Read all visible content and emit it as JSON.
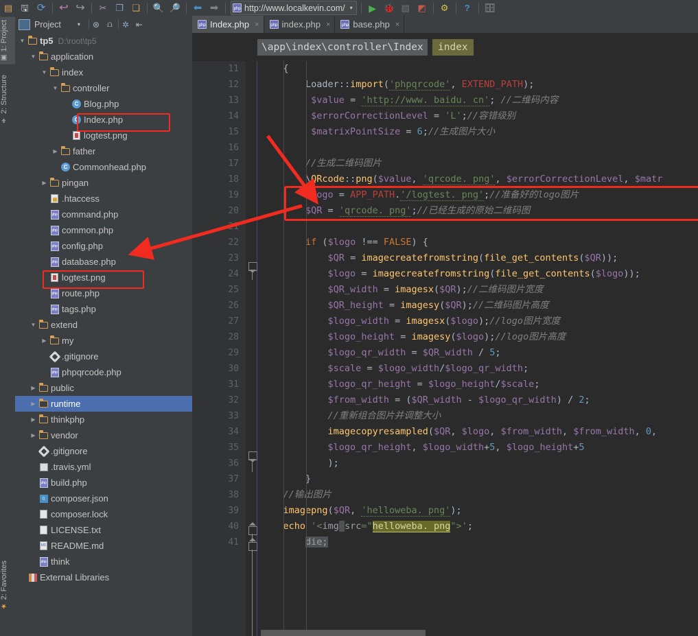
{
  "toolbar": {
    "icons": [
      {
        "name": "open-folder-icon",
        "glyph": "📁"
      },
      {
        "name": "save-all-icon",
        "glyph": "💾"
      },
      {
        "name": "sync-refresh-icon",
        "glyph": "↻"
      },
      {
        "name": "undo-icon",
        "glyph": "↶"
      },
      {
        "name": "redo-icon",
        "glyph": "↷"
      },
      {
        "name": "cut-icon",
        "glyph": "✂"
      },
      {
        "name": "copy-icon",
        "glyph": "❐"
      },
      {
        "name": "paste-icon",
        "glyph": "📋"
      },
      {
        "name": "find-icon",
        "glyph": "🔍"
      },
      {
        "name": "find-usages-icon",
        "glyph": "🔎"
      },
      {
        "name": "back-icon",
        "glyph": "⬅"
      },
      {
        "name": "forward-icon",
        "glyph": "➡"
      }
    ],
    "url_value": "http://www.localkevin.com/",
    "url_dropdown_glyph": "▾",
    "run_icon": "▶",
    "debug_icon": "🐞",
    "coverage_icon": "░",
    "profile_icon": "📊",
    "settings_icon": "⚙",
    "help_icon": "?",
    "deploy_icon": "🗄"
  },
  "left_strip": {
    "project_tab": "1: Project",
    "structure_tab": "2: Structure",
    "favorites_tab": "2: Favorites"
  },
  "project_panel": {
    "title": "Project",
    "caret": "▾",
    "buttons": [
      "⊕",
      "⨍",
      "⚙▾",
      "⇥"
    ]
  },
  "tree": {
    "items": [
      {
        "indent": 0,
        "twisty": "▼",
        "icon": "folder-open",
        "label": "tp5",
        "path": "D:\\root\\tp5",
        "bold": true,
        "selected": false
      },
      {
        "indent": 1,
        "twisty": "▼",
        "icon": "folder-open",
        "label": "application",
        "path": "",
        "bold": false,
        "selected": false
      },
      {
        "indent": 2,
        "twisty": "▼",
        "icon": "folder-open",
        "label": "index",
        "path": "",
        "bold": false,
        "selected": false
      },
      {
        "indent": 3,
        "twisty": "▼",
        "icon": "folder-open",
        "label": "controller",
        "path": "",
        "bold": false,
        "selected": false
      },
      {
        "indent": 4,
        "twisty": "",
        "icon": "class",
        "label": "Blog.php",
        "path": "",
        "bold": false,
        "selected": false
      },
      {
        "indent": 4,
        "twisty": "",
        "icon": "class",
        "label": "Index.php",
        "path": "",
        "bold": false,
        "selected": false,
        "highlight": true
      },
      {
        "indent": 4,
        "twisty": "",
        "icon": "png",
        "label": "logtest.png",
        "path": "",
        "bold": false,
        "selected": false
      },
      {
        "indent": 3,
        "twisty": "▶",
        "icon": "folder",
        "label": "father",
        "path": "",
        "bold": false,
        "selected": false
      },
      {
        "indent": 3,
        "twisty": "",
        "icon": "class",
        "label": "Commonhead.php",
        "path": "",
        "bold": false,
        "selected": false
      },
      {
        "indent": 2,
        "twisty": "▶",
        "icon": "folder",
        "label": "pingan",
        "path": "",
        "bold": false,
        "selected": false
      },
      {
        "indent": 2,
        "twisty": "",
        "icon": "htaccess",
        "label": ".htaccess",
        "path": "",
        "bold": false,
        "selected": false
      },
      {
        "indent": 2,
        "twisty": "",
        "icon": "php",
        "label": "command.php",
        "path": "",
        "bold": false,
        "selected": false
      },
      {
        "indent": 2,
        "twisty": "",
        "icon": "php",
        "label": "common.php",
        "path": "",
        "bold": false,
        "selected": false
      },
      {
        "indent": 2,
        "twisty": "",
        "icon": "php",
        "label": "config.php",
        "path": "",
        "bold": false,
        "selected": false
      },
      {
        "indent": 2,
        "twisty": "",
        "icon": "php",
        "label": "database.php",
        "path": "",
        "bold": false,
        "selected": false
      },
      {
        "indent": 2,
        "twisty": "",
        "icon": "png",
        "label": "logtest.png",
        "path": "",
        "bold": false,
        "selected": false,
        "highlight2": true
      },
      {
        "indent": 2,
        "twisty": "",
        "icon": "php",
        "label": "route.php",
        "path": "",
        "bold": false,
        "selected": false
      },
      {
        "indent": 2,
        "twisty": "",
        "icon": "php",
        "label": "tags.php",
        "path": "",
        "bold": false,
        "selected": false
      },
      {
        "indent": 1,
        "twisty": "▼",
        "icon": "folder-open",
        "label": "extend",
        "path": "",
        "bold": false,
        "selected": false
      },
      {
        "indent": 2,
        "twisty": "▶",
        "icon": "folder",
        "label": "my",
        "path": "",
        "bold": false,
        "selected": false
      },
      {
        "indent": 2,
        "twisty": "",
        "icon": "git",
        "label": ".gitignore",
        "path": "",
        "bold": false,
        "selected": false
      },
      {
        "indent": 2,
        "twisty": "",
        "icon": "php",
        "label": "phpqrcode.php",
        "path": "",
        "bold": false,
        "selected": false
      },
      {
        "indent": 1,
        "twisty": "▶",
        "icon": "folder",
        "label": "public",
        "path": "",
        "bold": false,
        "selected": false
      },
      {
        "indent": 1,
        "twisty": "▶",
        "icon": "folder",
        "label": "runtime",
        "path": "",
        "bold": false,
        "selected": true
      },
      {
        "indent": 1,
        "twisty": "▶",
        "icon": "folder",
        "label": "thinkphp",
        "path": "",
        "bold": false,
        "selected": false
      },
      {
        "indent": 1,
        "twisty": "▶",
        "icon": "folder",
        "label": "vendor",
        "path": "",
        "bold": false,
        "selected": false
      },
      {
        "indent": 1,
        "twisty": "",
        "icon": "git",
        "label": ".gitignore",
        "path": "",
        "bold": false,
        "selected": false
      },
      {
        "indent": 1,
        "twisty": "",
        "icon": "yml",
        "label": ".travis.yml",
        "path": "",
        "bold": false,
        "selected": false
      },
      {
        "indent": 1,
        "twisty": "",
        "icon": "php",
        "label": "build.php",
        "path": "",
        "bold": false,
        "selected": false
      },
      {
        "indent": 1,
        "twisty": "",
        "icon": "json",
        "label": "composer.json",
        "path": "",
        "bold": false,
        "selected": false
      },
      {
        "indent": 1,
        "twisty": "",
        "icon": "doc",
        "label": "composer.lock",
        "path": "",
        "bold": false,
        "selected": false
      },
      {
        "indent": 1,
        "twisty": "",
        "icon": "doc",
        "label": "LICENSE.txt",
        "path": "",
        "bold": false,
        "selected": false
      },
      {
        "indent": 1,
        "twisty": "",
        "icon": "md",
        "label": "README.md",
        "path": "",
        "bold": false,
        "selected": false
      },
      {
        "indent": 1,
        "twisty": "",
        "icon": "php",
        "label": "think",
        "path": "",
        "bold": false,
        "selected": false
      },
      {
        "indent": 0,
        "twisty": "",
        "icon": "extlib",
        "label": "External Libraries",
        "path": "",
        "bold": false,
        "selected": false
      }
    ]
  },
  "editor_tabs": [
    {
      "label": "Index.php",
      "active": true,
      "close": "×"
    },
    {
      "label": "index.php",
      "active": false,
      "close": "×"
    },
    {
      "label": "base.php",
      "active": false,
      "close": "×"
    }
  ],
  "breadcrumb": {
    "namespace": "\\app\\index\\controller\\Index",
    "method": "index"
  },
  "code": {
    "first_line": 11,
    "lines": [
      {
        "n": 11,
        "text": "{"
      },
      {
        "n": 12,
        "text": "Loader::import('phpqrcode', EXTEND_PATH);"
      },
      {
        "n": 13,
        "text": "$value = 'http://www.baidu.cn'; //二维码内容"
      },
      {
        "n": 14,
        "text": "$errorCorrectionLevel = 'L';//容错级别"
      },
      {
        "n": 15,
        "text": "$matrixPointSize = 6;//生成图片大小"
      },
      {
        "n": 16,
        "text": ""
      },
      {
        "n": 17,
        "text": "//生成二维码图片"
      },
      {
        "n": 18,
        "text": "\\QRcode::png($value, 'qrcode.png', $errorCorrectionLevel, $matr"
      },
      {
        "n": 19,
        "text": "$logo = APP_PATH.'/logtest.png';//准备好的logo图片"
      },
      {
        "n": 20,
        "text": "$QR = 'qrcode.png';//已经生成的原始二维码图"
      },
      {
        "n": 21,
        "text": ""
      },
      {
        "n": 22,
        "text": "if ($logo !== FALSE) {"
      },
      {
        "n": 23,
        "text": "$QR = imagecreatefromstring(file_get_contents($QR));"
      },
      {
        "n": 24,
        "text": "$logo = imagecreatefromstring(file_get_contents($logo));"
      },
      {
        "n": 25,
        "text": "$QR_width = imagesx($QR);//二维码图片宽度"
      },
      {
        "n": 26,
        "text": "$QR_height = imagesy($QR);//二维码图片高度"
      },
      {
        "n": 27,
        "text": "$logo_width = imagesx($logo);//logo图片宽度"
      },
      {
        "n": 28,
        "text": "$logo_height = imagesy($logo);//logo图片高度"
      },
      {
        "n": 29,
        "text": "$logo_qr_width = $QR_width / 5;"
      },
      {
        "n": 30,
        "text": "$scale = $logo_width/$logo_qr_width;"
      },
      {
        "n": 31,
        "text": "$logo_qr_height = $logo_height/$scale;"
      },
      {
        "n": 32,
        "text": "$from_width = ($QR_width - $logo_qr_width) / 2;"
      },
      {
        "n": 33,
        "text": "//重新组合图片并调整大小"
      },
      {
        "n": 34,
        "text": "imagecopyresampled($QR, $logo, $from_width, $from_width, 0,"
      },
      {
        "n": 35,
        "text": "$logo_qr_height, $logo_width+5, $logo_height+5"
      },
      {
        "n": 36,
        "text": ");"
      },
      {
        "n": 37,
        "text": "}"
      },
      {
        "n": 38,
        "text": "//输出图片"
      },
      {
        "n": 39,
        "text": "imagepng($QR, 'helloweba.png');"
      },
      {
        "n": 40,
        "text": "echo '<img src=\"helloweba.png\">';"
      },
      {
        "n": 41,
        "text": "die;"
      }
    ]
  },
  "annotations": {
    "highlight_color": "#f12b1f",
    "boxes": [
      "tree-index-php",
      "tree-logtest-png",
      "code-qrcode-png-line"
    ],
    "arrows": [
      "arrow-to-qrcode-line",
      "arrow-to-logo-line"
    ]
  }
}
